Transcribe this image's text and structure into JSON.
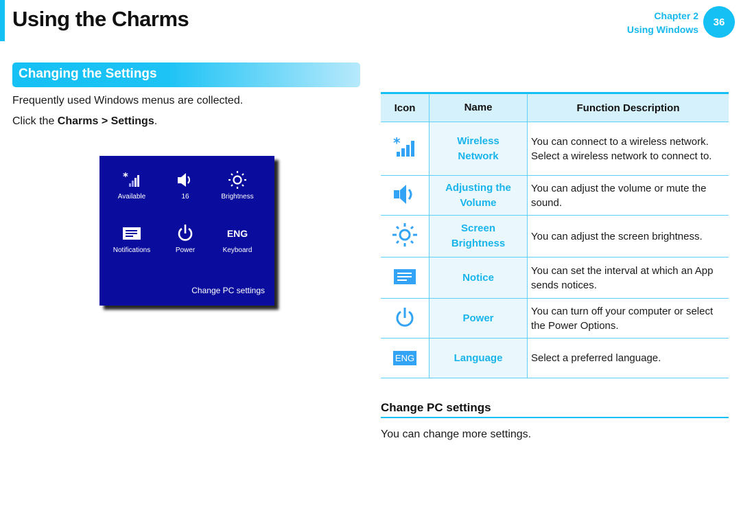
{
  "header": {
    "title": "Using the Charms",
    "chapter_label": "Chapter 2",
    "chapter_name": "Using Windows",
    "page_number": "36",
    "accent_color": "#14c0f4"
  },
  "section": {
    "title": "Changing the Settings",
    "intro": "Frequently used Windows menus are collected.",
    "click_prefix": "Click the ",
    "click_path": "Charms > Settings",
    "click_suffix": "."
  },
  "charms_panel": {
    "background": "#0a0c9e",
    "items": [
      {
        "icon": "wireless-signal-icon",
        "label": "Available"
      },
      {
        "icon": "volume-icon",
        "label": "16"
      },
      {
        "icon": "brightness-icon",
        "label": "Brightness"
      },
      {
        "icon": "notifications-icon",
        "label": "Notifications"
      },
      {
        "icon": "power-icon",
        "label": "Power"
      },
      {
        "icon": "keyboard-language-icon",
        "label": "Keyboard",
        "glyph": "ENG"
      }
    ],
    "link": "Change PC settings"
  },
  "table": {
    "headers": [
      "Icon",
      "Name",
      "Function Description"
    ],
    "rows": [
      {
        "icon": "wireless-signal-icon",
        "name_line1": "Wireless",
        "name_line2": "Network",
        "description": "You can connect to a wireless network. Select a wireless network to connect to."
      },
      {
        "icon": "volume-icon",
        "name_line1": "Adjusting the",
        "name_line2": "Volume",
        "description": "You can adjust the volume or mute the sound."
      },
      {
        "icon": "brightness-icon",
        "name_line1": "Screen",
        "name_line2": "Brightness",
        "description": "You can adjust the screen brightness."
      },
      {
        "icon": "notifications-icon",
        "name_line1": "Notice",
        "name_line2": "",
        "description": "You can set the interval at which an App sends notices."
      },
      {
        "icon": "power-icon",
        "name_line1": "Power",
        "name_line2": "",
        "description": "You can turn off your computer or select the Power Options."
      },
      {
        "icon": "language-icon",
        "glyph": "ENG",
        "name_line1": "Language",
        "name_line2": "",
        "description": "Select a preferred language."
      }
    ]
  },
  "change_pc_settings": {
    "title": "Change PC settings",
    "text": "You can change more settings."
  }
}
